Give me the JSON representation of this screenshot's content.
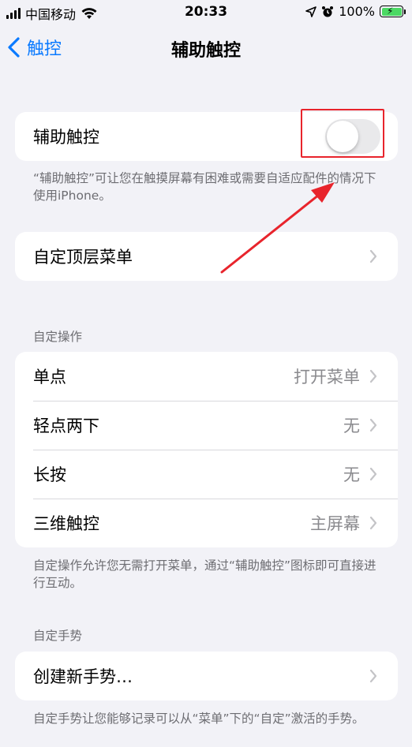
{
  "status_bar": {
    "carrier": "中国移动",
    "time": "20:33",
    "battery": "100%"
  },
  "nav": {
    "back_label": "触控",
    "title": "辅助触控"
  },
  "assistive_touch": {
    "label": "辅助触控",
    "enabled": false,
    "footnote": "“辅助触控”可让您在触摸屏幕有困难或需要自适应配件的情况下使用iPhone。"
  },
  "top_level_menu": {
    "label": "自定顶层菜单"
  },
  "custom_actions": {
    "header": "自定操作",
    "items": [
      {
        "label": "单点",
        "value": "打开菜单"
      },
      {
        "label": "轻点两下",
        "value": "无"
      },
      {
        "label": "长按",
        "value": "无"
      },
      {
        "label": "三维触控",
        "value": "主屏幕"
      }
    ],
    "footnote": "自定操作允许您无需打开菜单，通过“辅助触控”图标即可直接进行互动。"
  },
  "custom_gestures": {
    "header": "自定手势",
    "create_label": "创建新手势…",
    "footnote": "自定手势让您能够记录可以从“菜单”下的“自定”激活的手势。"
  },
  "colors": {
    "accent": "#0a7aff",
    "annotation": "#e8242c",
    "background": "#f2f2f7"
  }
}
